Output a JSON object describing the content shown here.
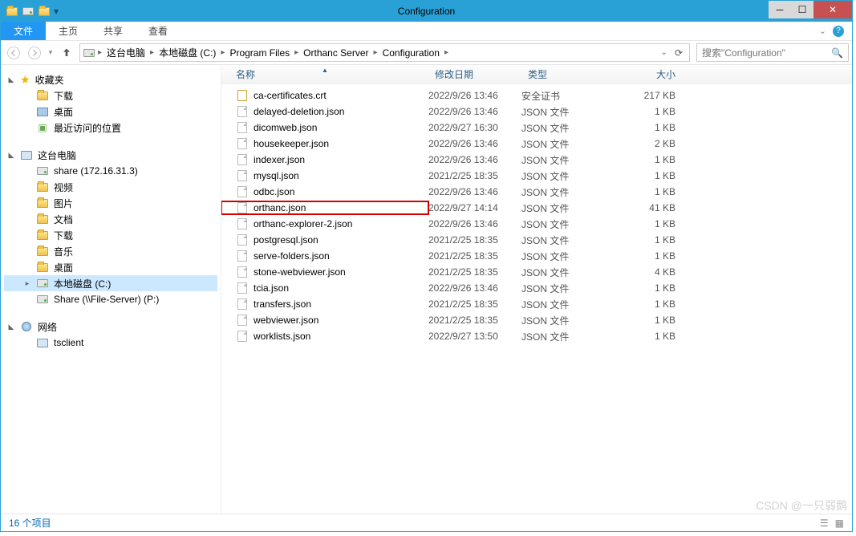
{
  "window": {
    "title": "Configuration"
  },
  "ribbon": {
    "file": "文件",
    "tabs": [
      "主页",
      "共享",
      "查看"
    ]
  },
  "breadcrumb": {
    "segments": [
      "这台电脑",
      "本地磁盘 (C:)",
      "Program Files",
      "Orthanc Server",
      "Configuration"
    ]
  },
  "search": {
    "placeholder": "搜索\"Configuration\""
  },
  "nav_pane": {
    "favorites": {
      "label": "收藏夹",
      "items": [
        {
          "label": "下载",
          "icon": "download"
        },
        {
          "label": "桌面",
          "icon": "desktop"
        },
        {
          "label": "最近访问的位置",
          "icon": "recent"
        }
      ]
    },
    "this_pc": {
      "label": "这台电脑",
      "items": [
        {
          "label": "share (172.16.31.3)",
          "icon": "netfolder"
        },
        {
          "label": "视频",
          "icon": "folder"
        },
        {
          "label": "图片",
          "icon": "folder"
        },
        {
          "label": "文档",
          "icon": "folder"
        },
        {
          "label": "下载",
          "icon": "folder"
        },
        {
          "label": "音乐",
          "icon": "folder"
        },
        {
          "label": "桌面",
          "icon": "folder"
        },
        {
          "label": "本地磁盘 (C:)",
          "icon": "drive",
          "selected": true
        },
        {
          "label": "Share (\\\\File-Server) (P:)",
          "icon": "netdrive"
        }
      ]
    },
    "network": {
      "label": "网络",
      "items": [
        {
          "label": "tsclient",
          "icon": "pc"
        }
      ]
    }
  },
  "columns": {
    "name": "名称",
    "date": "修改日期",
    "type": "类型",
    "size": "大小"
  },
  "highlight_file": "orthanc.json",
  "files": [
    {
      "name": "ca-certificates.crt",
      "date": "2022/9/26 13:46",
      "type": "安全证书",
      "size": "217 KB",
      "icon": "cert"
    },
    {
      "name": "delayed-deletion.json",
      "date": "2022/9/26 13:46",
      "type": "JSON 文件",
      "size": "1 KB",
      "icon": "file"
    },
    {
      "name": "dicomweb.json",
      "date": "2022/9/27 16:30",
      "type": "JSON 文件",
      "size": "1 KB",
      "icon": "file"
    },
    {
      "name": "housekeeper.json",
      "date": "2022/9/26 13:46",
      "type": "JSON 文件",
      "size": "2 KB",
      "icon": "file"
    },
    {
      "name": "indexer.json",
      "date": "2022/9/26 13:46",
      "type": "JSON 文件",
      "size": "1 KB",
      "icon": "file"
    },
    {
      "name": "mysql.json",
      "date": "2021/2/25 18:35",
      "type": "JSON 文件",
      "size": "1 KB",
      "icon": "file"
    },
    {
      "name": "odbc.json",
      "date": "2022/9/26 13:46",
      "type": "JSON 文件",
      "size": "1 KB",
      "icon": "file"
    },
    {
      "name": "orthanc.json",
      "date": "2022/9/27 14:14",
      "type": "JSON 文件",
      "size": "41 KB",
      "icon": "file"
    },
    {
      "name": "orthanc-explorer-2.json",
      "date": "2022/9/26 13:46",
      "type": "JSON 文件",
      "size": "1 KB",
      "icon": "file"
    },
    {
      "name": "postgresql.json",
      "date": "2021/2/25 18:35",
      "type": "JSON 文件",
      "size": "1 KB",
      "icon": "file"
    },
    {
      "name": "serve-folders.json",
      "date": "2021/2/25 18:35",
      "type": "JSON 文件",
      "size": "1 KB",
      "icon": "file"
    },
    {
      "name": "stone-webviewer.json",
      "date": "2021/2/25 18:35",
      "type": "JSON 文件",
      "size": "4 KB",
      "icon": "file"
    },
    {
      "name": "tcia.json",
      "date": "2022/9/26 13:46",
      "type": "JSON 文件",
      "size": "1 KB",
      "icon": "file"
    },
    {
      "name": "transfers.json",
      "date": "2021/2/25 18:35",
      "type": "JSON 文件",
      "size": "1 KB",
      "icon": "file"
    },
    {
      "name": "webviewer.json",
      "date": "2021/2/25 18:35",
      "type": "JSON 文件",
      "size": "1 KB",
      "icon": "file"
    },
    {
      "name": "worklists.json",
      "date": "2022/9/27 13:50",
      "type": "JSON 文件",
      "size": "1 KB",
      "icon": "file"
    }
  ],
  "status": {
    "count_label": "16 个项目"
  },
  "watermark": "CSDN @一只弱鹅"
}
